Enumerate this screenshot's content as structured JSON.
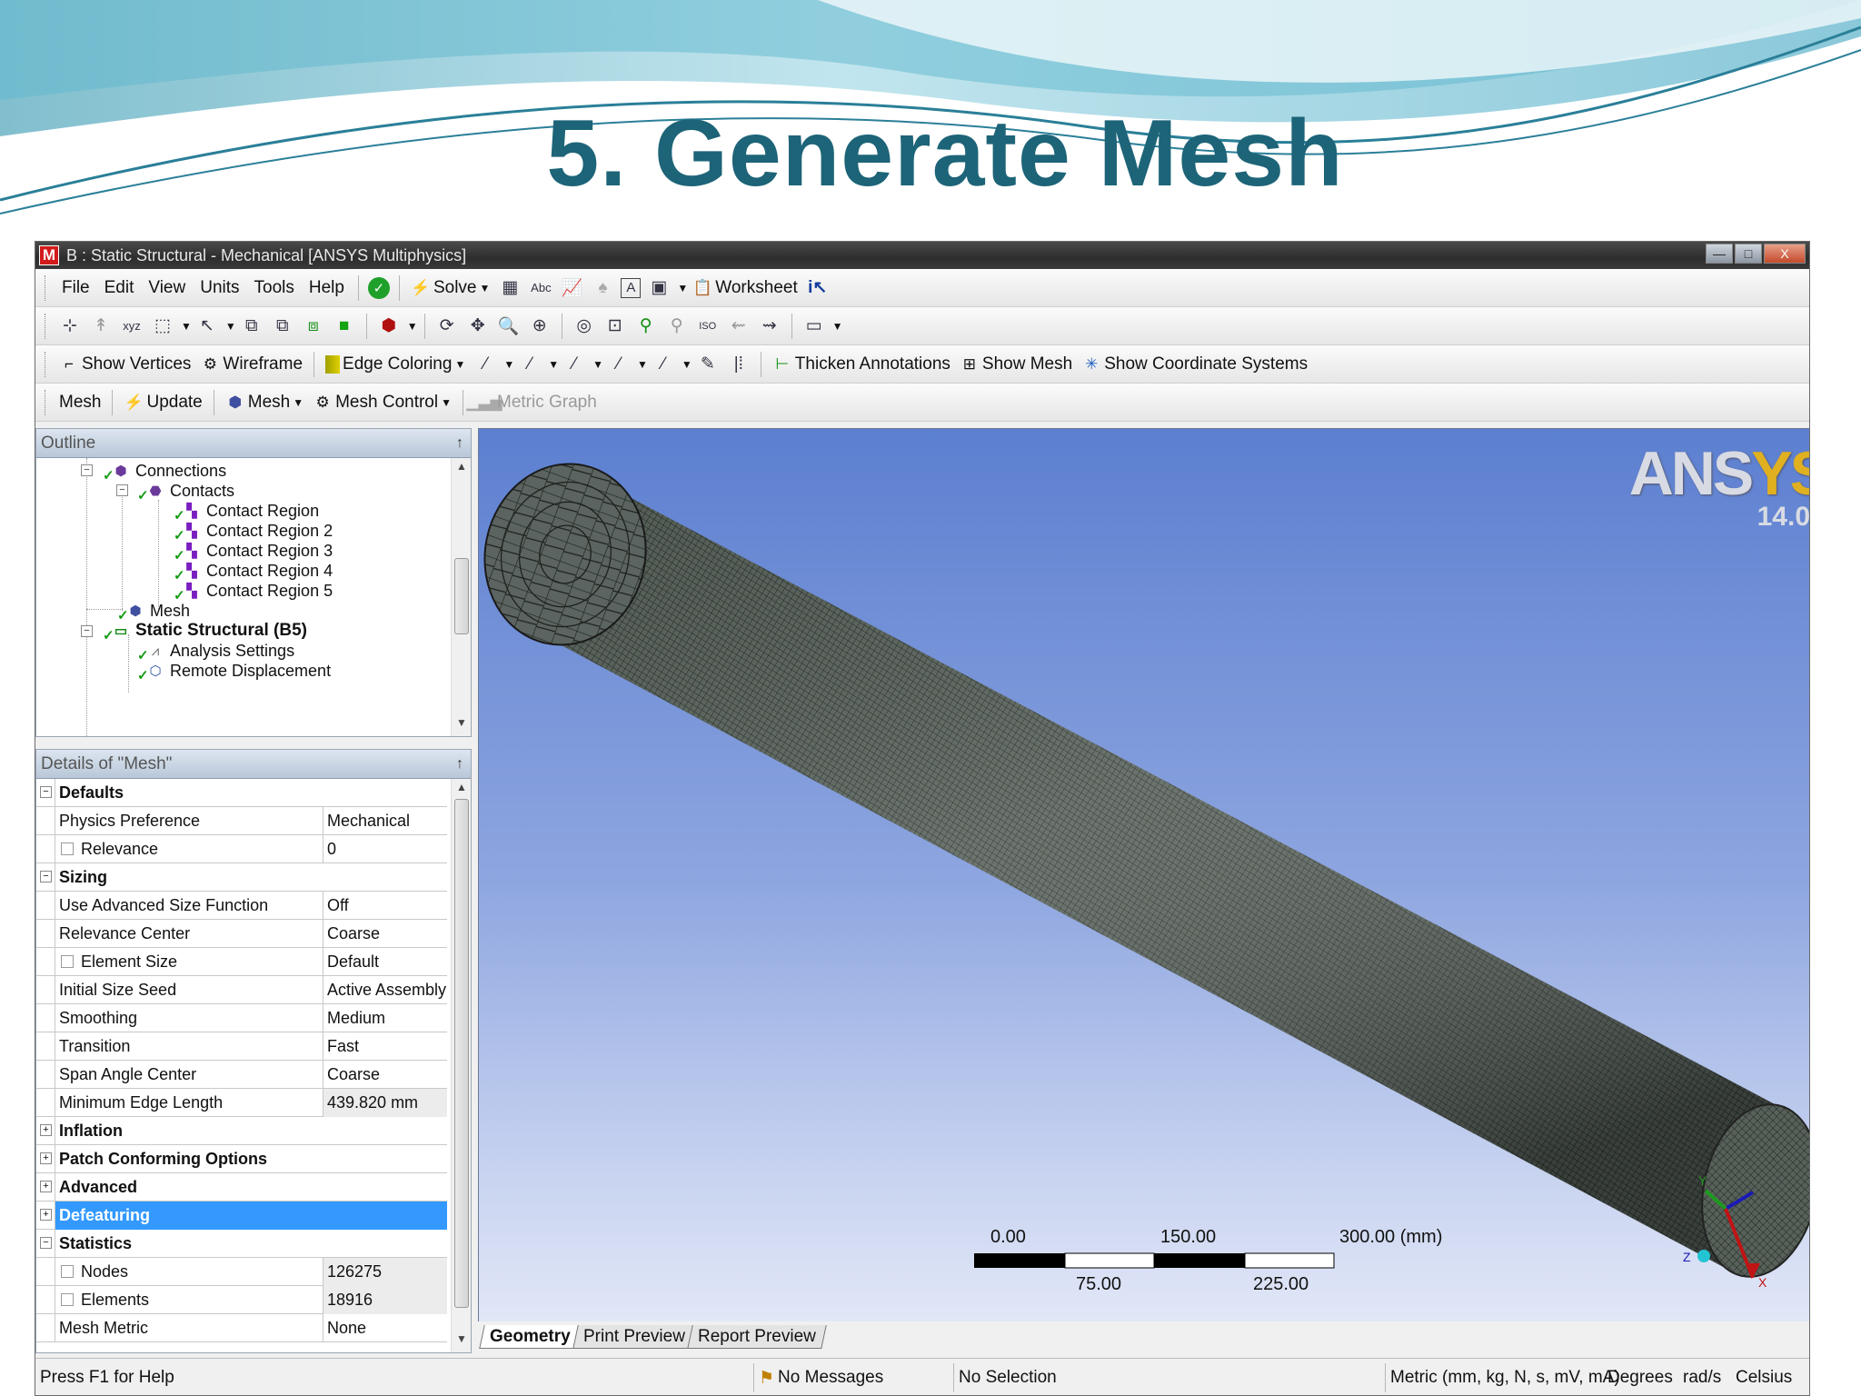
{
  "slide": {
    "title": "5. Generate Mesh"
  },
  "window": {
    "title": "B : Static Structural - Mechanical [ANSYS Multiphysics]",
    "logo_letter": "M",
    "minimize": "—",
    "maximize": "□",
    "close": "X"
  },
  "menu": {
    "items": [
      "File",
      "Edit",
      "View",
      "Units",
      "Tools",
      "Help"
    ],
    "solve": "Solve",
    "worksheet": "Worksheet"
  },
  "graphics_toolbar": {
    "show_vertices": "Show Vertices",
    "wireframe": "Wireframe",
    "edge_coloring": "Edge Coloring",
    "thicken_annotations": "Thicken Annotations",
    "show_mesh": "Show Mesh",
    "show_coordinate_systems": "Show Coordinate Systems"
  },
  "context_toolbar": {
    "label": "Mesh",
    "update": "Update",
    "mesh": "Mesh",
    "mesh_control": "Mesh Control",
    "metric_graph": "Metric Graph"
  },
  "outline": {
    "title": "Outline",
    "pin": "↑",
    "nodes": [
      {
        "label": "Connections",
        "icon": "connections-icon"
      },
      {
        "label": "Contacts",
        "icon": "contacts-icon"
      },
      {
        "label": "Contact Region",
        "icon": "contact-region-icon"
      },
      {
        "label": "Contact Region 2",
        "icon": "contact-region-icon"
      },
      {
        "label": "Contact Region 3",
        "icon": "contact-region-icon"
      },
      {
        "label": "Contact Region 4",
        "icon": "contact-region-icon"
      },
      {
        "label": "Contact Region 5",
        "icon": "contact-region-icon"
      },
      {
        "label": "Mesh",
        "icon": "mesh-icon"
      },
      {
        "label": "Static Structural (B5)",
        "icon": "static-structural-icon"
      },
      {
        "label": "Analysis Settings",
        "icon": "analysis-settings-icon"
      },
      {
        "label": "Remote Displacement",
        "icon": "remote-displacement-icon"
      }
    ]
  },
  "details": {
    "title": "Details of \"Mesh\"",
    "pin": "↑",
    "rows": [
      {
        "name": "Defaults",
        "cat": true,
        "expanded": true
      },
      {
        "name": "Physics Preference",
        "value": "Mechanical"
      },
      {
        "name": "Relevance",
        "value": "0",
        "checkbox": true
      },
      {
        "name": "Sizing",
        "cat": true,
        "expanded": true
      },
      {
        "name": "Use Advanced Size Function",
        "value": "Off"
      },
      {
        "name": "Relevance Center",
        "value": "Coarse"
      },
      {
        "name": "Element Size",
        "value": "Default",
        "checkbox": true
      },
      {
        "name": "Initial Size Seed",
        "value": "Active Assembly"
      },
      {
        "name": "Smoothing",
        "value": "Medium"
      },
      {
        "name": "Transition",
        "value": "Fast"
      },
      {
        "name": "Span Angle Center",
        "value": "Coarse"
      },
      {
        "name": "Minimum Edge Length",
        "value": "439.820 mm",
        "readonly": true
      },
      {
        "name": "Inflation",
        "cat": true,
        "expanded": false
      },
      {
        "name": "Patch Conforming Options",
        "cat": true,
        "expanded": false
      },
      {
        "name": "Advanced",
        "cat": true,
        "expanded": false
      },
      {
        "name": "Defeaturing",
        "cat": true,
        "expanded": false,
        "selected": true
      },
      {
        "name": "Statistics",
        "cat": true,
        "expanded": true
      },
      {
        "name": "Nodes",
        "value": "126275",
        "checkbox": true,
        "readonly": true
      },
      {
        "name": "Elements",
        "value": "18916",
        "checkbox": true,
        "readonly": true
      },
      {
        "name": "Mesh Metric",
        "value": "None"
      }
    ]
  },
  "viewport": {
    "logo": "ANSYS",
    "version": "14.0",
    "scale": {
      "top": [
        "0.00",
        "150.00",
        "300.00 (mm)"
      ],
      "bottom": [
        "75.00",
        "225.00"
      ]
    },
    "tabs": [
      "Geometry",
      "Print Preview",
      "Report Preview"
    ],
    "active_tab": "Geometry",
    "axis_labels": [
      "X",
      "Y",
      "Z"
    ]
  },
  "status": {
    "help": "Press F1 for Help",
    "messages": "No Messages",
    "selection": "No Selection",
    "units": "Metric (mm, kg, N, s, mV, mA)",
    "angle": "Degrees",
    "rate": "rad/s",
    "temp": "Celsius"
  },
  "colors": {
    "title": "#1d6478",
    "selection": "#3399ff",
    "mesh": "#5d6b5d",
    "viewport_top": "#5c7fd0"
  }
}
